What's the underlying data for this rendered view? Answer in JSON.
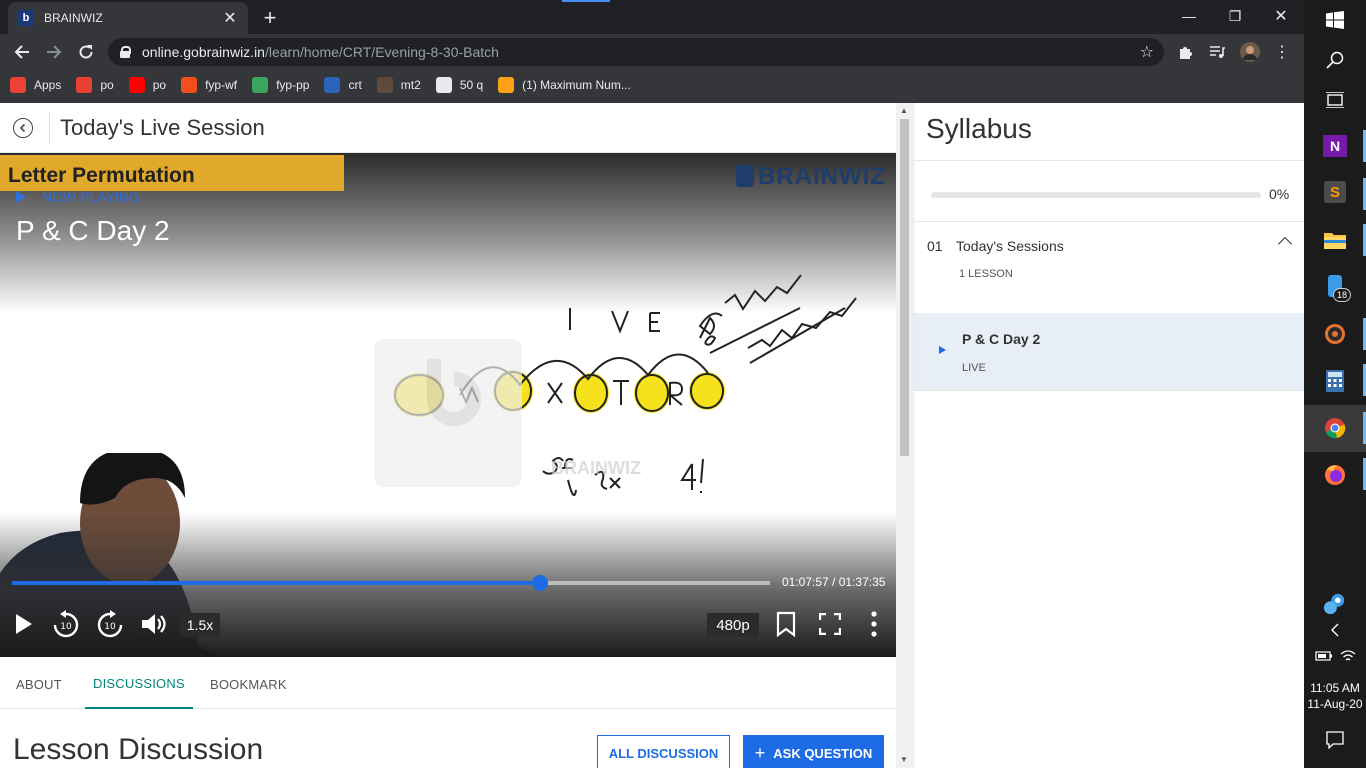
{
  "browser": {
    "tab_title": "BRAINWIZ",
    "tab_favicon": "b",
    "tab_close": "✕",
    "new_tab": "+",
    "url_host": "online.gobrainwiz.in",
    "url_path": "/learn/home/CRT/Evening-8-30-Batch",
    "window_controls": {
      "minimize": "—",
      "restore": "❐",
      "close": "✕"
    },
    "bookmarks": [
      {
        "label": "Apps",
        "icon": "apps-grid-icon",
        "color": "#ea4335"
      },
      {
        "label": "po",
        "icon": "chrome-icon",
        "color": "#e94235"
      },
      {
        "label": "po",
        "icon": "youtube-icon",
        "color": "#ff0000"
      },
      {
        "label": "fyp-wf",
        "icon": "figma-icon",
        "color": "#f24e1e"
      },
      {
        "label": "fyp-pp",
        "icon": "pdf-icon",
        "color": "#3aa55b"
      },
      {
        "label": "crt",
        "icon": "brainwiz-icon",
        "color": "#2a63b8"
      },
      {
        "label": "mt2",
        "icon": "cc-icon",
        "color": "#5f4b3b"
      },
      {
        "label": "50 q",
        "icon": "globe-icon",
        "color": "#e8eaed"
      },
      {
        "label": "(1) Maximum Num...",
        "icon": "leetcode-icon",
        "color": "#ffa116"
      }
    ]
  },
  "page": {
    "header_title": "Today's Live Session",
    "video": {
      "topic_banner": "Letter Permutation",
      "logo_text": "BRAINWIZ",
      "watermark_text": "BRAINWIZ",
      "now_playing": "NOW PLAYING",
      "title": "P & C Day 2",
      "current_time": "01:07:57",
      "total_time": "01:37:35",
      "progress": 0.696,
      "speed": "1.5x",
      "quality": "480p",
      "rewind_seconds": "10",
      "forward_seconds": "10"
    },
    "tabs": [
      {
        "label": "ABOUT",
        "active": false
      },
      {
        "label": "DISCUSSIONS",
        "active": true
      },
      {
        "label": "BOOKMARK",
        "active": false
      }
    ],
    "lesson_discussion_title": "Lesson Discussion",
    "all_discussion_label": "ALL DISCUSSION",
    "ask_question_label": "ASK QUESTION",
    "ask_question_plus": "+"
  },
  "syllabus": {
    "title": "Syllabus",
    "progress_percent": 0,
    "progress_label": "0%",
    "sections": [
      {
        "number": "01",
        "name": "Today's Sessions",
        "meta": "1 LESSON",
        "lessons": [
          {
            "name": "P & C Day 2",
            "status": "LIVE"
          }
        ]
      }
    ]
  },
  "taskbar": {
    "time": "11:05 AM",
    "date": "11-Aug-20",
    "badge_count": "18"
  },
  "colors": {
    "accent": "#1e6be6",
    "tab_active": "#00857c",
    "banner": "#e0a92a",
    "highlight_row": "#e8eef6"
  }
}
